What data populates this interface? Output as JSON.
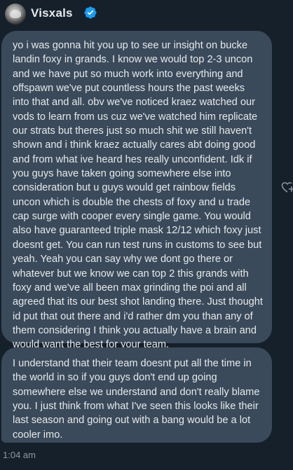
{
  "header": {
    "username": "Visxals"
  },
  "messages": [
    {
      "text": "yo i was gonna hit you up to see ur insight on bucke landin foxy in grands. I know we would top 2-3 uncon and we have put so much work into everything and offspawn we've put countless hours the past weeks into that and all. obv we've noticed kraez watched our vods to learn from us cuz we've watched him replicate our strats but theres just so much shit we still haven't shown and i think kraez actually cares abt doing good and from what ive heard hes really unconfident. Idk if you guys have taken going somewhere else into consideration but u guys would get rainbow fields uncon which is double the chests of foxy and u trade cap surge with cooper every single game. You would also have guaranteed triple mask 12/12 which foxy just doesnt get. You can run test runs in customs to see but yeah. Yeah you can say why we dont go there or whatever but we know we can top 2 this grands with foxy and we've all been max grinding the poi and all agreed that its our best shot landing there. Just thought id put that out there and i'd rather dm you than any of them considering I think you actually have a brain and would want the best for your team."
    },
    {
      "text": "I understand that their team doesnt put all the time in the world in so if you guys don't end up going somewhere else we understand and don't really blame you. I just think from what I've seen this looks like their last season and going out with a bang would be a lot cooler imo.",
      "timestamp": "1:04 am"
    }
  ],
  "colors": {
    "background": "#15202b",
    "bubble": "#3a4a5b",
    "verified": "#1d9bf0",
    "muted_text": "#8b98a5"
  },
  "icons": {
    "verified": "verified-badge-icon",
    "reaction": "add-reaction-icon"
  }
}
